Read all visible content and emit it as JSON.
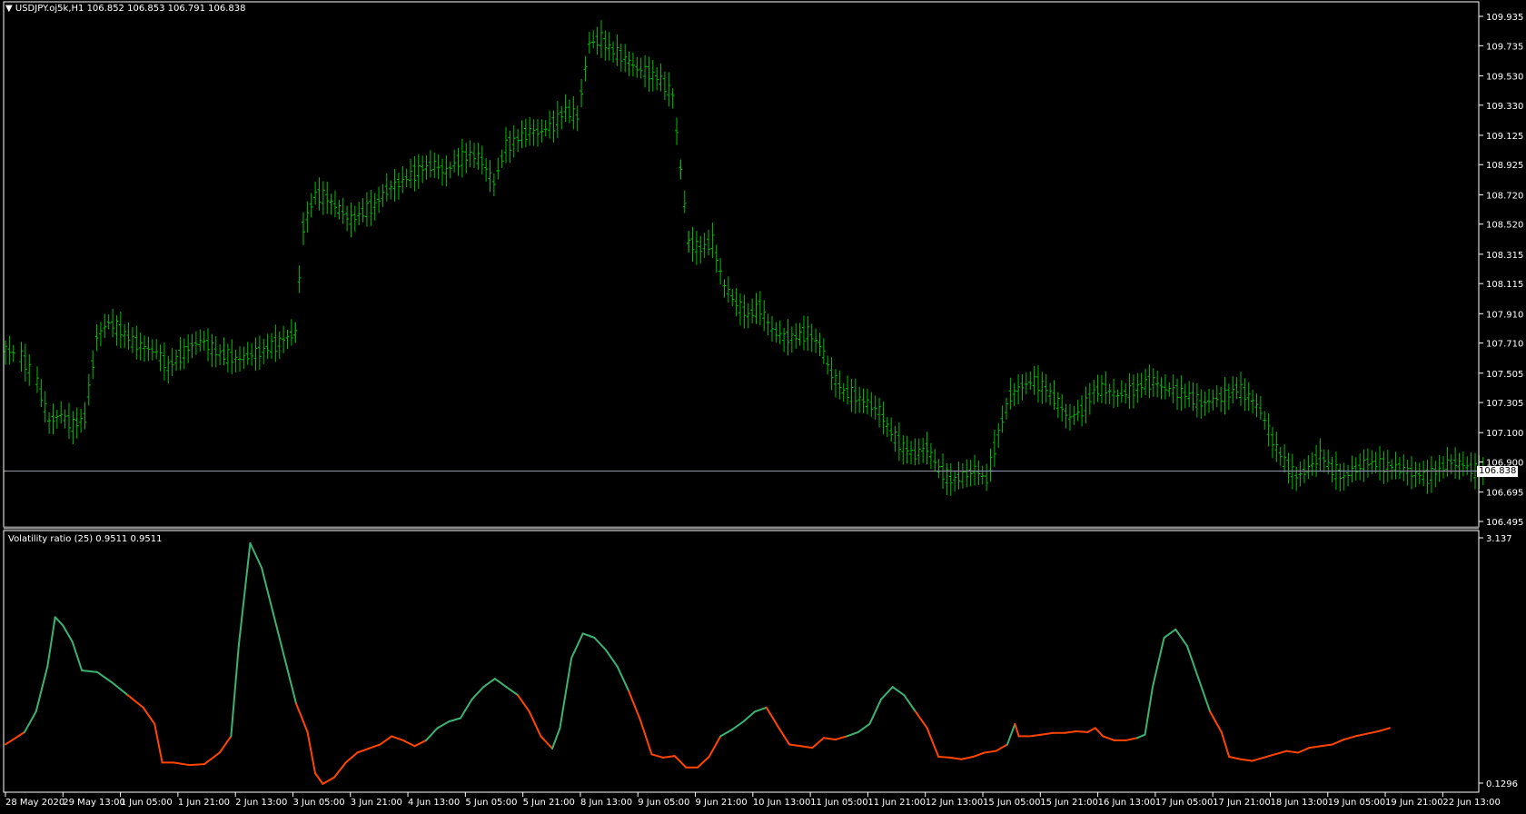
{
  "chart_window": {
    "symbol_line": "USDJPY.oj5k,H1  106.852 106.853 106.791 106.838",
    "current_price_label": "106.838",
    "indicator_line": "Volatility ratio (25) 0.9511 0.9511"
  },
  "colors": {
    "background": "#000000",
    "candle": "#00c000",
    "axis": "#ffffff",
    "price_line": "#8c9aa6",
    "ratio_up": "#3cb371",
    "ratio_down": "#ff4500"
  },
  "chart_data": [
    {
      "type": "line",
      "name_on_chart": "USDJPY.oj5k,H1",
      "y_ticks": [
        "109.935",
        "109.735",
        "109.530",
        "109.330",
        "109.125",
        "108.925",
        "108.720",
        "108.520",
        "108.315",
        "108.115",
        "107.910",
        "107.710",
        "107.505",
        "107.305",
        "107.100",
        "106.900",
        "106.695",
        "106.495"
      ],
      "ylim": [
        106.495,
        109.935
      ],
      "current_price": 106.838,
      "ohlc_last": {
        "open": 106.852,
        "high": 106.853,
        "low": 106.791,
        "close": 106.838
      },
      "x_ticks": [
        "28 May 2020",
        "29 May 13:00",
        "1 Jun 05:00",
        "1 Jun 21:00",
        "2 Jun 13:00",
        "3 Jun 05:00",
        "3 Jun 21:00",
        "4 Jun 13:00",
        "5 Jun 05:00",
        "5 Jun 21:00",
        "8 Jun 13:00",
        "9 Jun 05:00",
        "9 Jun 21:00",
        "10 Jun 13:00",
        "11 Jun 05:00",
        "11 Jun 21:00",
        "12 Jun 13:00",
        "15 Jun 05:00",
        "15 Jun 21:00",
        "16 Jun 13:00",
        "17 Jun 05:00",
        "17 Jun 21:00",
        "18 Jun 13:00",
        "19 Jun 05:00",
        "19 Jun 21:00",
        "22 Jun 13:00"
      ],
      "close_path": [
        [
          0,
          107.67
        ],
        [
          8,
          107.62
        ],
        [
          16,
          107.45
        ],
        [
          22,
          107.18
        ],
        [
          28,
          107.22
        ],
        [
          34,
          107.15
        ],
        [
          40,
          107.2
        ],
        [
          46,
          107.75
        ],
        [
          52,
          107.85
        ],
        [
          58,
          107.8
        ],
        [
          64,
          107.72
        ],
        [
          70,
          107.68
        ],
        [
          76,
          107.65
        ],
        [
          82,
          107.55
        ],
        [
          88,
          107.62
        ],
        [
          94,
          107.7
        ],
        [
          100,
          107.72
        ],
        [
          106,
          107.65
        ],
        [
          112,
          107.62
        ],
        [
          118,
          107.6
        ],
        [
          124,
          107.63
        ],
        [
          130,
          107.66
        ],
        [
          136,
          107.7
        ],
        [
          142,
          107.75
        ],
        [
          146,
          107.78
        ],
        [
          150,
          108.5
        ],
        [
          156,
          108.72
        ],
        [
          162,
          108.7
        ],
        [
          168,
          108.62
        ],
        [
          174,
          108.55
        ],
        [
          180,
          108.6
        ],
        [
          186,
          108.65
        ],
        [
          192,
          108.75
        ],
        [
          198,
          108.8
        ],
        [
          204,
          108.85
        ],
        [
          210,
          108.9
        ],
        [
          216,
          108.92
        ],
        [
          222,
          108.88
        ],
        [
          228,
          108.95
        ],
        [
          234,
          109.0
        ],
        [
          240,
          108.95
        ],
        [
          246,
          108.8
        ],
        [
          252,
          109.05
        ],
        [
          258,
          109.1
        ],
        [
          264,
          109.15
        ],
        [
          270,
          109.15
        ],
        [
          276,
          109.2
        ],
        [
          282,
          109.3
        ],
        [
          288,
          109.25
        ],
        [
          294,
          109.75
        ],
        [
          300,
          109.78
        ],
        [
          306,
          109.7
        ],
        [
          312,
          109.65
        ],
        [
          318,
          109.58
        ],
        [
          324,
          109.55
        ],
        [
          330,
          109.5
        ],
        [
          336,
          109.4
        ],
        [
          340,
          108.9
        ],
        [
          344,
          108.4
        ],
        [
          350,
          108.35
        ],
        [
          356,
          108.4
        ],
        [
          362,
          108.1
        ],
        [
          368,
          107.98
        ],
        [
          374,
          107.9
        ],
        [
          380,
          107.95
        ],
        [
          386,
          107.8
        ],
        [
          392,
          107.75
        ],
        [
          398,
          107.75
        ],
        [
          404,
          107.78
        ],
        [
          410,
          107.7
        ],
        [
          416,
          107.5
        ],
        [
          422,
          107.38
        ],
        [
          428,
          107.35
        ],
        [
          434,
          107.3
        ],
        [
          440,
          107.25
        ],
        [
          446,
          107.1
        ],
        [
          452,
          107.0
        ],
        [
          458,
          106.95
        ],
        [
          464,
          107.0
        ],
        [
          470,
          106.85
        ],
        [
          476,
          106.78
        ],
        [
          482,
          106.8
        ],
        [
          488,
          106.85
        ],
        [
          494,
          106.78
        ],
        [
          500,
          107.1
        ],
        [
          506,
          107.35
        ],
        [
          512,
          107.42
        ],
        [
          518,
          107.45
        ],
        [
          524,
          107.4
        ],
        [
          530,
          107.3
        ],
        [
          536,
          107.2
        ],
        [
          542,
          107.25
        ],
        [
          548,
          107.38
        ],
        [
          554,
          107.4
        ],
        [
          560,
          107.35
        ],
        [
          566,
          107.38
        ],
        [
          572,
          107.42
        ],
        [
          578,
          107.45
        ],
        [
          584,
          107.4
        ],
        [
          590,
          107.38
        ],
        [
          596,
          107.35
        ],
        [
          602,
          107.3
        ],
        [
          608,
          107.32
        ],
        [
          614,
          107.35
        ],
        [
          620,
          107.4
        ],
        [
          626,
          107.35
        ],
        [
          632,
          107.25
        ],
        [
          638,
          107.05
        ],
        [
          644,
          106.9
        ],
        [
          650,
          106.8
        ],
        [
          656,
          106.85
        ],
        [
          662,
          106.95
        ],
        [
          668,
          106.85
        ],
        [
          674,
          106.8
        ],
        [
          680,
          106.85
        ],
        [
          686,
          106.9
        ],
        [
          692,
          106.88
        ],
        [
          698,
          106.87
        ],
        [
          704,
          106.85
        ],
        [
          710,
          106.82
        ],
        [
          716,
          106.8
        ],
        [
          722,
          106.85
        ],
        [
          728,
          106.9
        ],
        [
          734,
          106.88
        ],
        [
          740,
          106.84
        ]
      ]
    },
    {
      "type": "line",
      "name_on_chart": "Volatility ratio (25)",
      "y_ticks": [
        "3.137",
        "0.1296"
      ],
      "ylim": [
        0.1296,
        3.137
      ],
      "values_last": [
        0.9511,
        0.9511
      ],
      "series_path": [
        [
          0,
          0.6,
          0
        ],
        [
          10,
          0.75,
          0
        ],
        [
          16,
          1.0,
          1
        ],
        [
          22,
          1.55,
          1
        ],
        [
          26,
          2.15,
          1
        ],
        [
          30,
          2.05,
          1
        ],
        [
          35,
          1.85,
          1
        ],
        [
          40,
          1.5,
          1
        ],
        [
          48,
          1.48,
          1
        ],
        [
          56,
          1.35,
          1
        ],
        [
          64,
          1.2,
          1
        ],
        [
          72,
          1.05,
          0
        ],
        [
          78,
          0.85,
          0
        ],
        [
          82,
          0.38,
          0
        ],
        [
          88,
          0.38,
          0
        ],
        [
          96,
          0.35,
          0
        ],
        [
          104,
          0.36,
          0
        ],
        [
          112,
          0.5,
          0
        ],
        [
          118,
          0.7,
          0
        ],
        [
          122,
          1.8,
          1
        ],
        [
          128,
          3.05,
          1
        ],
        [
          134,
          2.75,
          1
        ],
        [
          140,
          2.2,
          1
        ],
        [
          146,
          1.65,
          1
        ],
        [
          152,
          1.1,
          1
        ],
        [
          158,
          0.75,
          0
        ],
        [
          162,
          0.25,
          0
        ],
        [
          166,
          0.12,
          0
        ],
        [
          172,
          0.2,
          0
        ],
        [
          178,
          0.38,
          0
        ],
        [
          184,
          0.5,
          0
        ],
        [
          190,
          0.55,
          0
        ],
        [
          196,
          0.6,
          0
        ],
        [
          202,
          0.7,
          0
        ],
        [
          208,
          0.65,
          0
        ],
        [
          214,
          0.58,
          0
        ],
        [
          220,
          0.65,
          0
        ],
        [
          226,
          0.8,
          1
        ],
        [
          232,
          0.88,
          1
        ],
        [
          238,
          0.92,
          1
        ],
        [
          244,
          1.15,
          1
        ],
        [
          250,
          1.3,
          1
        ],
        [
          256,
          1.4,
          1
        ],
        [
          262,
          1.3,
          1
        ],
        [
          268,
          1.2,
          1
        ],
        [
          274,
          1.0,
          0
        ],
        [
          280,
          0.7,
          0
        ],
        [
          286,
          0.55,
          0
        ],
        [
          290,
          0.8,
          1
        ],
        [
          296,
          1.65,
          1
        ],
        [
          302,
          1.95,
          1
        ],
        [
          308,
          1.9,
          1
        ],
        [
          314,
          1.75,
          1
        ],
        [
          320,
          1.55,
          1
        ],
        [
          326,
          1.25,
          1
        ],
        [
          332,
          0.9,
          0
        ],
        [
          338,
          0.48,
          0
        ],
        [
          344,
          0.44,
          0
        ],
        [
          350,
          0.46,
          0
        ],
        [
          356,
          0.32,
          0
        ],
        [
          362,
          0.32,
          0
        ],
        [
          368,
          0.45,
          0
        ],
        [
          374,
          0.7,
          0
        ],
        [
          380,
          0.78,
          1
        ],
        [
          386,
          0.88,
          1
        ],
        [
          392,
          1.0,
          1
        ],
        [
          398,
          1.05,
          1
        ],
        [
          404,
          0.82,
          0
        ],
        [
          410,
          0.6,
          0
        ],
        [
          416,
          0.58,
          0
        ],
        [
          422,
          0.56,
          0
        ],
        [
          428,
          0.68,
          0
        ],
        [
          434,
          0.66,
          0
        ],
        [
          440,
          0.7,
          0
        ],
        [
          446,
          0.75,
          1
        ],
        [
          452,
          0.85,
          1
        ],
        [
          458,
          1.15,
          1
        ],
        [
          464,
          1.3,
          1
        ],
        [
          470,
          1.2,
          1
        ],
        [
          476,
          1.0,
          1
        ],
        [
          482,
          0.8,
          0
        ],
        [
          488,
          0.45,
          0
        ],
        [
          494,
          0.44,
          0
        ],
        [
          500,
          0.42,
          0
        ],
        [
          506,
          0.45,
          0
        ],
        [
          512,
          0.5,
          0
        ],
        [
          518,
          0.52,
          0
        ],
        [
          524,
          0.6,
          0
        ],
        [
          528,
          0.85,
          1
        ],
        [
          530,
          0.7,
          0
        ],
        [
          536,
          0.7,
          0
        ],
        [
          542,
          0.72,
          0
        ],
        [
          548,
          0.74,
          0
        ],
        [
          554,
          0.74,
          0
        ],
        [
          560,
          0.76,
          0
        ],
        [
          566,
          0.75,
          0
        ],
        [
          570,
          0.8,
          0
        ],
        [
          574,
          0.7,
          0
        ],
        [
          580,
          0.65,
          0
        ],
        [
          586,
          0.65,
          0
        ],
        [
          592,
          0.68,
          0
        ],
        [
          596,
          0.72,
          1
        ],
        [
          600,
          1.3,
          1
        ],
        [
          606,
          1.9,
          1
        ],
        [
          612,
          2.0,
          1
        ],
        [
          618,
          1.8,
          1
        ],
        [
          624,
          1.4,
          1
        ],
        [
          630,
          1.0,
          1
        ],
        [
          636,
          0.75,
          0
        ],
        [
          640,
          0.45,
          0
        ],
        [
          646,
          0.42,
          0
        ],
        [
          652,
          0.4,
          0
        ],
        [
          658,
          0.44,
          0
        ],
        [
          664,
          0.48,
          0
        ],
        [
          670,
          0.52,
          0
        ],
        [
          676,
          0.5,
          0
        ],
        [
          682,
          0.56,
          0
        ],
        [
          688,
          0.58,
          0
        ],
        [
          694,
          0.6,
          0
        ],
        [
          700,
          0.66,
          0
        ],
        [
          706,
          0.7,
          0
        ],
        [
          712,
          0.73,
          0
        ],
        [
          718,
          0.76,
          0
        ],
        [
          724,
          0.8,
          0
        ]
      ]
    }
  ]
}
